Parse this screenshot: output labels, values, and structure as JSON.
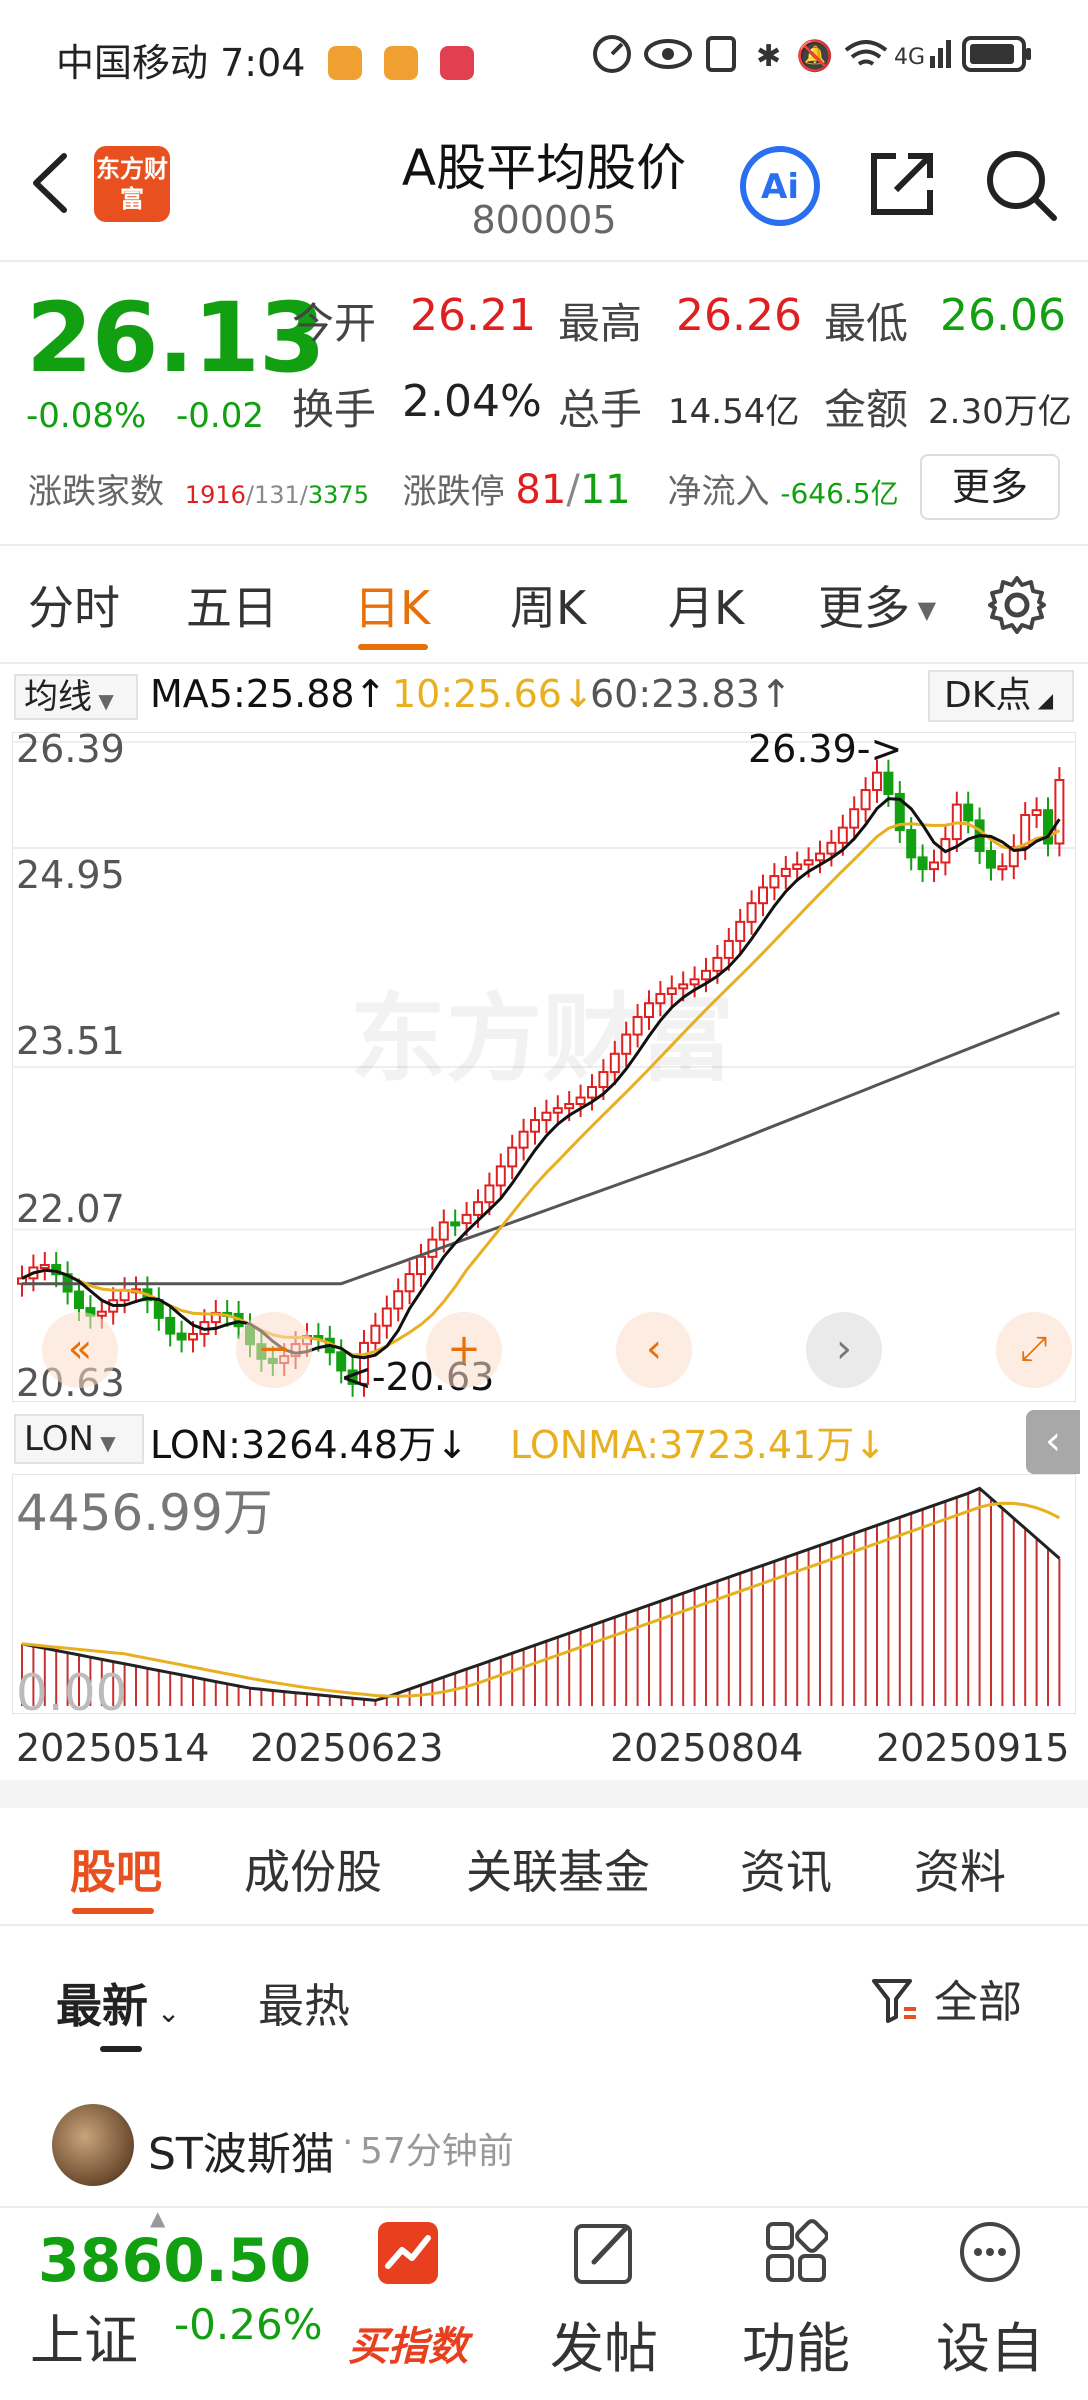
{
  "status_bar": {
    "carrier": "中国移动",
    "time": "7:04"
  },
  "header": {
    "logo_text": "东方财富",
    "title": "A股平均股价",
    "code": "800005",
    "ai_label": "Ai"
  },
  "quote": {
    "price": "26.13",
    "change_pct": "-0.08%",
    "change_abs": "-0.02",
    "open_label": "今开",
    "open": "26.21",
    "high_label": "最高",
    "high": "26.26",
    "low_label": "最低",
    "low": "26.06",
    "turnover_label": "换手",
    "turnover": "2.04%",
    "volume_label": "总手",
    "volume": "14.54亿",
    "amount_label": "金额",
    "amount": "2.30万亿",
    "breadth_label": "涨跌家数",
    "breadth_up": "1916",
    "breadth_flat": "131",
    "breadth_down": "3375",
    "limit_label": "涨跌停",
    "limit_up": "81",
    "limit_down": "11",
    "netflow_label": "净流入",
    "netflow": "-646.5亿",
    "more_label": "更多"
  },
  "period_tabs": [
    "分时",
    "五日",
    "日K",
    "周K",
    "月K",
    "更多"
  ],
  "active_period": "日K",
  "indicators": {
    "ma_select": "均线",
    "ma5": "MA5:25.88↑",
    "ma10": "10:25.66↓",
    "ma60": "60:23.83↑",
    "dk_label": "DK点",
    "watermark": "东方财富",
    "y_ticks": [
      "26.39",
      "24.95",
      "23.51",
      "22.07",
      "20.63"
    ],
    "high_marker": "26.39->",
    "low_marker": "<-20.63",
    "lon_select": "LON",
    "lon": "LON:3264.48万↓",
    "lonma": "LONMA:3723.41万↓",
    "lon_max": "4456.99万",
    "lon_min": "0.00",
    "dates": [
      "20250514",
      "20250623",
      "20250804",
      "20250915"
    ]
  },
  "colors": {
    "up": "#e02020",
    "down": "#12a012",
    "accent": "#e8700a",
    "ma5": "#111111",
    "ma10": "#e8b020",
    "ma60": "#555555"
  },
  "content_tabs": [
    "股吧",
    "成份股",
    "关联基金",
    "资讯",
    "资料"
  ],
  "sort": {
    "latest": "最新",
    "hot": "最热",
    "filter": "全部"
  },
  "post": {
    "user": "ST波斯猫",
    "time": "57分钟前"
  },
  "bottom_nav": {
    "index_value": "3860.50",
    "index_name": "上证",
    "index_change": "-0.26%",
    "items": [
      "买指数",
      "发帖",
      "功能",
      "设自选"
    ]
  }
}
